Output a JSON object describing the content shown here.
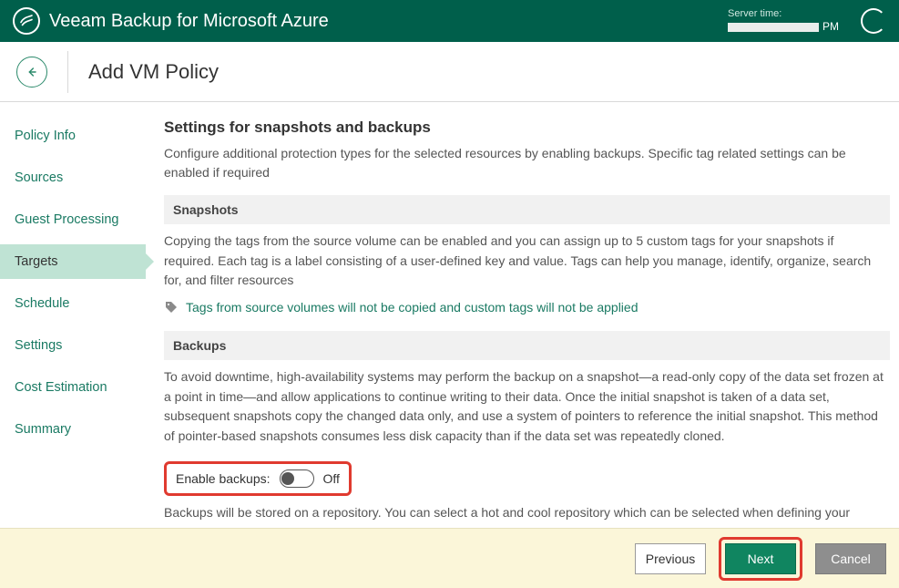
{
  "topbar": {
    "app_title": "Veeam Backup for Microsoft Azure",
    "server_time_label": "Server time:",
    "server_time_suffix": "PM"
  },
  "header": {
    "page_title": "Add VM Policy"
  },
  "sidebar": {
    "items": [
      {
        "label": "Policy Info",
        "active": false
      },
      {
        "label": "Sources",
        "active": false
      },
      {
        "label": "Guest Processing",
        "active": false
      },
      {
        "label": "Targets",
        "active": true
      },
      {
        "label": "Schedule",
        "active": false
      },
      {
        "label": "Settings",
        "active": false
      },
      {
        "label": "Cost Estimation",
        "active": false
      },
      {
        "label": "Summary",
        "active": false
      }
    ]
  },
  "content": {
    "heading": "Settings for snapshots and backups",
    "intro": "Configure additional protection types for the selected resources by enabling backups. Specific tag related settings can be enabled if required",
    "snapshots": {
      "title": "Snapshots",
      "body": "Copying the tags from the source volume can be enabled and you can assign up to 5 custom tags for your snapshots if required. Each tag is a label consisting of a user-defined key and value. Tags can help you manage, identify, organize, search for, and filter resources",
      "tag_link": "Tags from source volumes will not be copied and custom tags will not be applied"
    },
    "backups": {
      "title": "Backups",
      "body": "To avoid downtime, high-availability systems may perform the backup on a snapshot—a read-only copy of the data set frozen at a point in time—and allow applications to continue writing to their data. Once the initial snapshot is taken of a data set, subsequent snapshots copy the changed data only, and use a system of pointers to reference the initial snapshot. This method of pointer-based snapshots consumes less disk capacity than if the data set was repeatedly cloned.",
      "enable_label": "Enable backups:",
      "enable_state": "Off",
      "footer_note": "Backups will be stored on a repository. You can select a hot and cool repository which can be selected when defining your schedule"
    }
  },
  "footer": {
    "previous": "Previous",
    "next": "Next",
    "cancel": "Cancel"
  }
}
